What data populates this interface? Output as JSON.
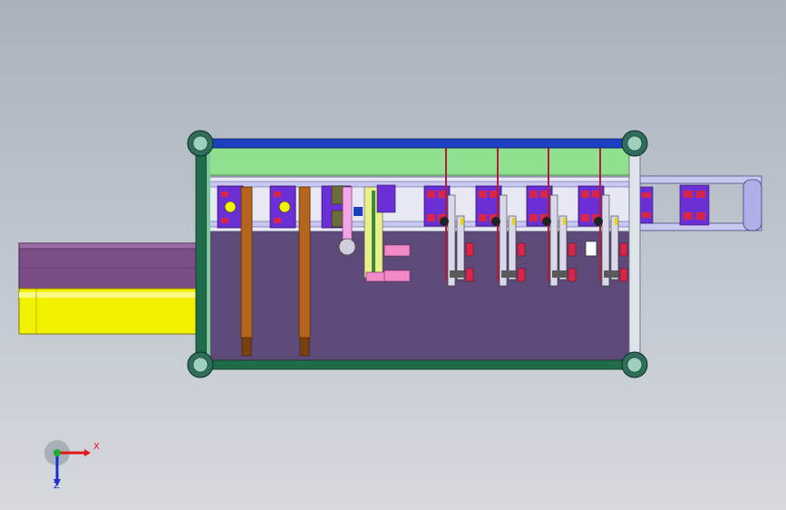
{
  "viewport": {
    "background_top": "#a9b1bd",
    "background_bottom": "#d6d9de"
  },
  "model": {
    "frame_color": "#1f6b4a",
    "top_rail_color": "#1a3fbf",
    "panel_green": "#8fe08f",
    "floor_purple": "#5e4a78",
    "conveyor_color": "#c8c8f0",
    "cylinder_color": "#b5651d",
    "actuator_purple": "#6b2fd6",
    "actuator_red": "#d7264a",
    "feed_yellow": "#f2f200",
    "feed_tray_purple": "#7a4d86"
  },
  "triad": {
    "x_label": "X",
    "z_label": "Z",
    "x_color": "#e01818",
    "y_color": "#1fae2a",
    "z_color": "#1a2fd0"
  }
}
